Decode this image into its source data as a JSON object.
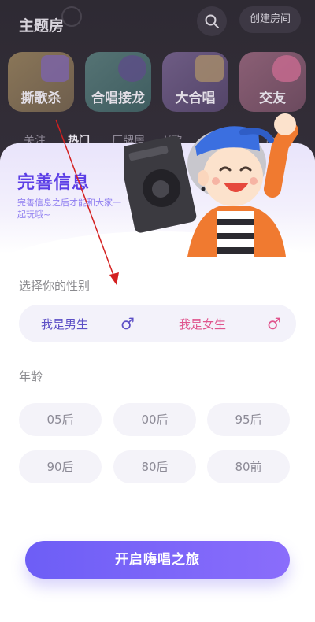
{
  "background_app": {
    "title": "主题房",
    "create_room_label": "创建房间",
    "categories": [
      {
        "label": "撕歌杀"
      },
      {
        "label": "合唱接龙"
      },
      {
        "label": "大合唱"
      },
      {
        "label": "交友"
      }
    ],
    "tabs": [
      "关注",
      "热门",
      "厂牌房",
      "K歌",
      "合唱"
    ]
  },
  "sheet": {
    "title": "完善信息",
    "subtitle": "完善信息之后才能和大家一起玩哦~",
    "gender_label": "选择你的性别",
    "gender_options": [
      {
        "label": "我是男生",
        "symbol": "♂"
      },
      {
        "label": "我是女生",
        "symbol": "♂"
      }
    ],
    "age_label": "年龄",
    "age_options": [
      "05后",
      "00后",
      "95后",
      "90后",
      "80后",
      "80前"
    ],
    "start_button": "开启嗨唱之旅"
  },
  "colors": {
    "accent": "#5b3ee6",
    "male": "#5c4fc6",
    "female": "#e0558d",
    "button_gradient_start": "#6d5ef6",
    "button_gradient_end": "#8a6dfb",
    "annotation_arrow": "#d42020"
  },
  "icons": {
    "search": "search-icon",
    "male": "male-icon",
    "female": "female-icon",
    "mascot": "boombox-mascot-illustration"
  }
}
